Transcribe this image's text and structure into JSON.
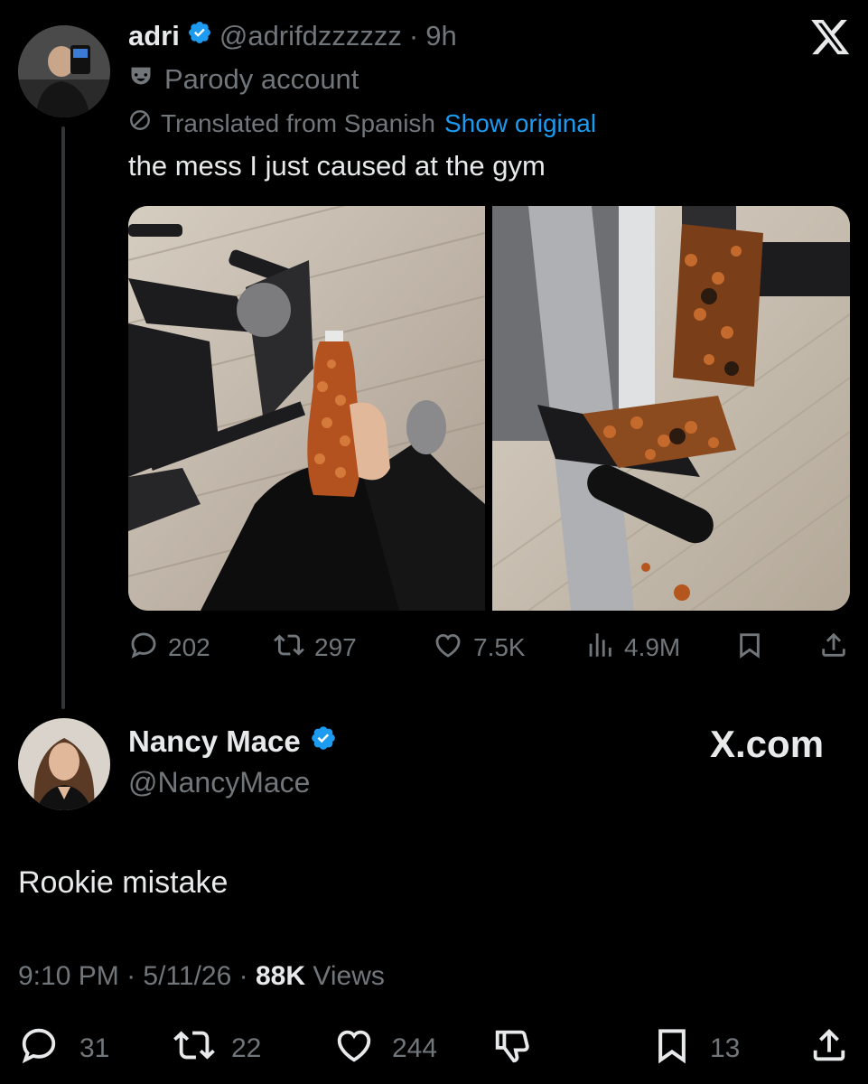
{
  "tweet": {
    "author_name": "adri",
    "author_handle": "@adrifdzzzzzz",
    "separator": "·",
    "time": "9h",
    "parody_label": "Parody account",
    "translated_label": "Translated from Spanish",
    "show_original": "Show original",
    "text": "the mess I just caused at the gym",
    "stats": {
      "replies": "202",
      "reposts": "297",
      "likes": "7.5K",
      "views": "4.9M"
    }
  },
  "reply": {
    "author_name": "Nancy Mace",
    "author_handle": "@NancyMace",
    "brand": "X.com",
    "text": "Rookie mistake",
    "time": "9:10 PM",
    "sep1": "·",
    "date": "5/11/26",
    "sep2": "·",
    "views_count": "88K",
    "views_label": "Views",
    "stats": {
      "replies": "31",
      "reposts": "22",
      "likes": "244",
      "bookmarks": "13"
    }
  },
  "colors": {
    "background": "#000000",
    "text": "#e7e9ea",
    "muted": "#71767b",
    "link": "#1d9bf0",
    "verified": "#1d9bf0"
  },
  "icons": [
    "verified-badge-icon",
    "parody-mask-icon",
    "translate-icon",
    "x-logo-icon",
    "reply-icon",
    "repost-icon",
    "like-icon",
    "views-icon",
    "bookmark-icon",
    "share-icon",
    "downvote-icon"
  ]
}
